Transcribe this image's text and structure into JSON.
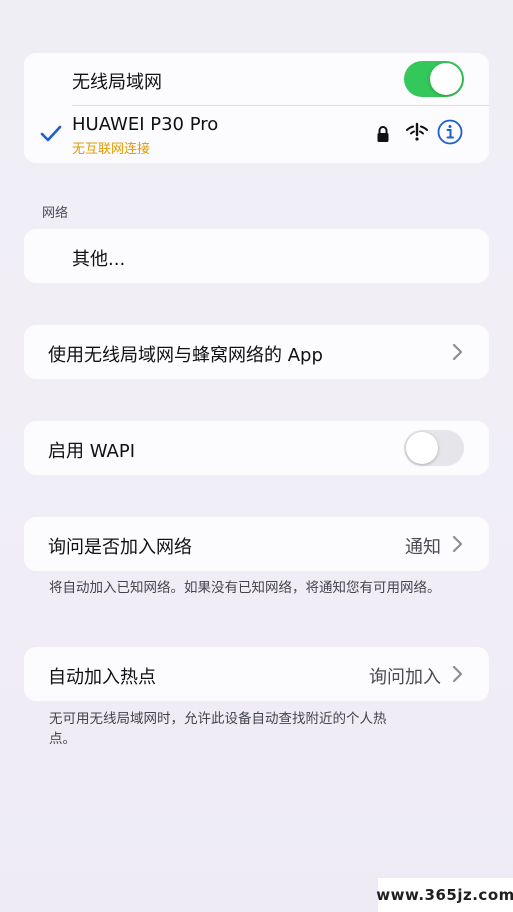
{
  "wlan": {
    "title": "无线局域网",
    "enabled": true,
    "connected_network": {
      "name": "HUAWEI P30 Pro",
      "status": "无互联网连接",
      "icons": [
        "checkmark-icon",
        "lock-icon",
        "wifi-no-internet-icon",
        "info-icon"
      ]
    }
  },
  "networks_section": {
    "header": "网络",
    "other_label": "其他..."
  },
  "apps_row": {
    "label": "使用无线局域网与蜂窝网络的 App"
  },
  "wapi_row": {
    "label": "启用 WAPI",
    "enabled": false
  },
  "ask_join_row": {
    "label": "询问是否加入网络",
    "value": "通知",
    "footnote": "将自动加入已知网络。如果没有已知网络，将通知您有可用网络。"
  },
  "auto_hotspot_row": {
    "label": "自动加入热点",
    "value": "询问加入",
    "footnote": "无可用无线局域网时，允许此设备自动查找附近的个人热点。"
  },
  "watermark": "www.365jz.com",
  "colors": {
    "toggle_on": "#34c759",
    "toggle_off": "#e5e5ea",
    "accent_blue": "#1b5fcf",
    "warning_text": "#e29b00"
  }
}
